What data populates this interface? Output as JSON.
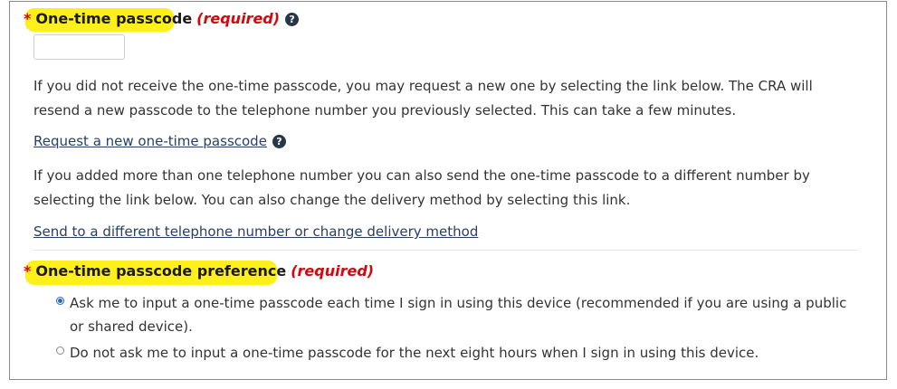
{
  "passcode_field": {
    "required_marker": "*",
    "label": "One-time passcode",
    "required_text": "(required)",
    "help_icon": "question-circle-icon",
    "value": ""
  },
  "resend_paragraph": "If you did not receive the one-time passcode, you may request a new one by selecting the link below. The CRA will resend a new passcode to the telephone number you previously selected. This can take a few minutes.",
  "request_link": {
    "label": "Request a new one-time passcode",
    "help_icon": "question-circle-icon"
  },
  "other_number_paragraph": "If you added more than one telephone number you can also send the one-time passcode to a different number by selecting the link below. You can also change the delivery method by selecting this link.",
  "different_number_link": "Send to a different telephone number or change delivery method",
  "preference": {
    "required_marker": "*",
    "label": "One-time passcode preference",
    "required_text": "(required)",
    "options": [
      {
        "label": "Ask me to input a one-time passcode each time I sign in using this device (recommended if you are using a public or shared device).",
        "selected": true
      },
      {
        "label": "Do not ask me to input a one-time passcode for the next eight hours when I sign in using this device.",
        "selected": false
      }
    ]
  },
  "colors": {
    "required_red": "#d3080c",
    "highlight_yellow": "#ffef1a",
    "link_blue": "#284162",
    "icon_navy": "#26374a",
    "radio_blue": "#2a67c9"
  }
}
